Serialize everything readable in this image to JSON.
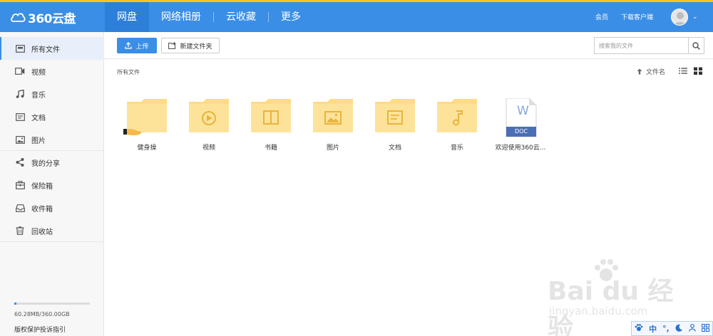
{
  "header": {
    "logo_text": "360云盘",
    "nav": [
      {
        "label": "网盘",
        "active": true
      },
      {
        "label": "网络相册",
        "active": false
      },
      {
        "label": "云收藏",
        "active": false
      },
      {
        "label": "更多",
        "active": false
      }
    ],
    "member_label": "会员",
    "download_label": "下载客户端",
    "accent_color": "#3a8ee6",
    "stripe_color": "#f5c518"
  },
  "sidebar": {
    "items": [
      {
        "label": "所有文件",
        "icon": "all-files-icon",
        "active": true
      },
      {
        "label": "视频",
        "icon": "video-icon"
      },
      {
        "label": "音乐",
        "icon": "music-icon"
      },
      {
        "label": "文档",
        "icon": "document-icon"
      },
      {
        "label": "图片",
        "icon": "image-icon"
      },
      {
        "label": "我的分享",
        "icon": "share-icon"
      },
      {
        "label": "保险箱",
        "icon": "safe-box-icon"
      },
      {
        "label": "收件箱",
        "icon": "inbox-icon"
      },
      {
        "label": "回收站",
        "icon": "trash-icon"
      }
    ],
    "storage_text": "60.28MB/360.00GB",
    "storage_used_fraction": 0.03,
    "report_link": "版权保护投诉指引"
  },
  "toolbar": {
    "upload_label": "上传",
    "new_folder_label": "新建文件夹",
    "search_placeholder": "搜索我的文件"
  },
  "content": {
    "breadcrumb": "所有文件",
    "sort_label": "文件名",
    "files": [
      {
        "name": "健身操",
        "type": "folder",
        "badge": "shared-hand-icon"
      },
      {
        "name": "视频",
        "type": "folder",
        "badge": "play-icon"
      },
      {
        "name": "书籍",
        "type": "folder",
        "badge": "book-icon"
      },
      {
        "name": "图片",
        "type": "folder",
        "badge": "picture-icon"
      },
      {
        "name": "文档",
        "type": "folder",
        "badge": "doc-lines-icon"
      },
      {
        "name": "音乐",
        "type": "folder",
        "badge": "note-icon"
      },
      {
        "name": "欢迎使用360云...",
        "type": "doc",
        "badge_letter": "W",
        "badge_label": "DOC"
      }
    ]
  },
  "watermark": {
    "text": "Bai du 经验",
    "sub": "jingyan.baidu.com"
  },
  "ime": {
    "items": [
      "中"
    ]
  }
}
